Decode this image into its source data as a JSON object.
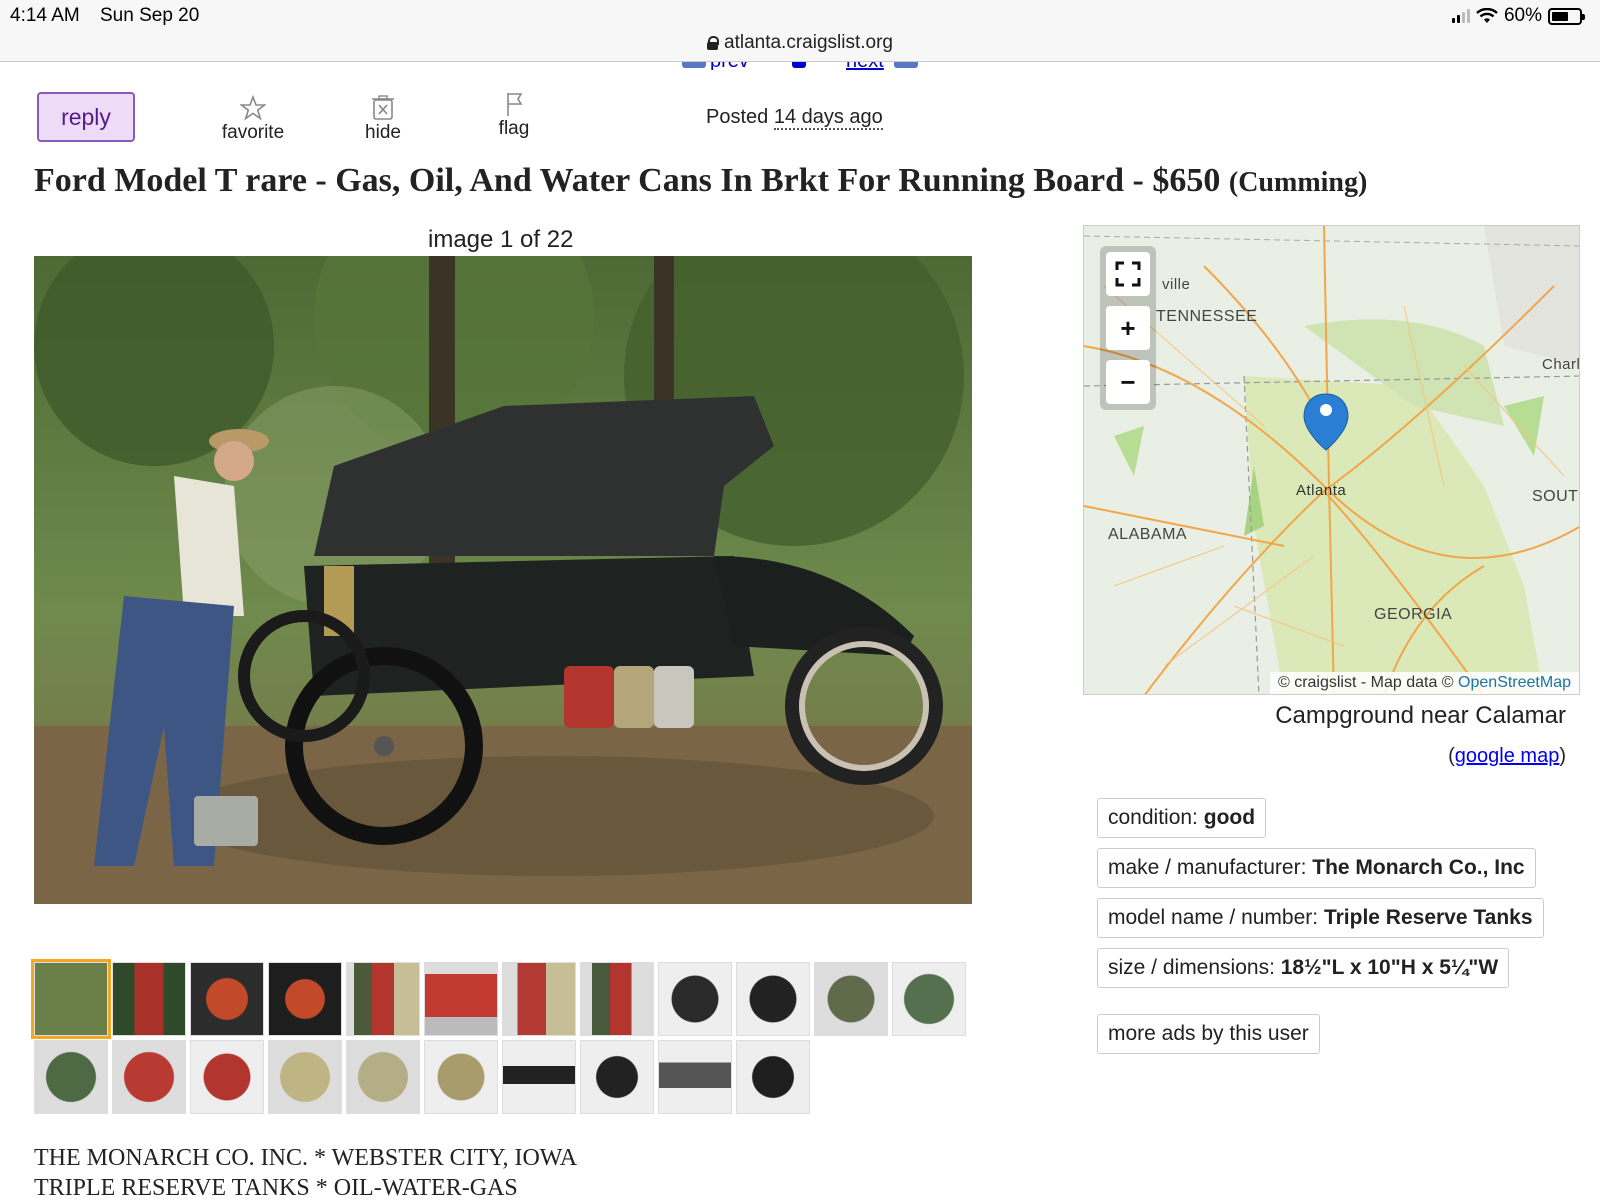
{
  "status_bar": {
    "time": "4:14 AM",
    "date": "Sun Sep 20",
    "battery": "60%"
  },
  "browser": {
    "url": "atlanta.craigslist.org"
  },
  "nav": {
    "prev": "prev",
    "next": "next"
  },
  "actions": {
    "reply": "reply",
    "favorite": "favorite",
    "hide": "hide",
    "flag": "flag",
    "posted_label": "Posted",
    "posted_date": "14 days ago"
  },
  "listing": {
    "title": "Ford Model T rare - Gas, Oil, And Water Cans In Brkt For Running Board - $650",
    "location": "(Cumming)"
  },
  "gallery": {
    "counter": "image 1 of 22",
    "thumbnail_count": 22,
    "selected_index": 0
  },
  "map": {
    "fullscreen_icon": "fullscreen-icon",
    "zoom_in": "+",
    "zoom_out": "−",
    "labels": {
      "ville": "ville",
      "tennessee": "TENNESSEE",
      "charl": "Charl",
      "atlanta": "Atlanta",
      "south": "SOUTH",
      "alabama": "ALABAMA",
      "georgia": "GEORGIA"
    },
    "attribution_text": "© craigslist - Map data ©",
    "attribution_link": "OpenStreetMap",
    "place": "Campground near Calamar",
    "google_map_link": "google map"
  },
  "attributes": [
    {
      "label": "condition:",
      "value": "good"
    },
    {
      "label": "make / manufacturer:",
      "value": "The Monarch Co., Inc"
    },
    {
      "label": "model name / number:",
      "value": "Triple Reserve Tanks"
    },
    {
      "label": "size / dimensions:",
      "value": "18½\"L x 10\"H x 5¼\"W"
    }
  ],
  "more_ads": "more ads by this user",
  "description": {
    "line1": "THE MONARCH CO. INC. * WEBSTER CITY, IOWA",
    "line2": "TRIPLE RESERVE TANKS * OIL-WATER-GAS"
  },
  "colors": {
    "reply_bg": "#ecdcf7",
    "reply_border": "#8a5cb8",
    "link": "#0000ee",
    "thumb_selected": "#f5a623",
    "map_pin": "#2a7fd4"
  }
}
